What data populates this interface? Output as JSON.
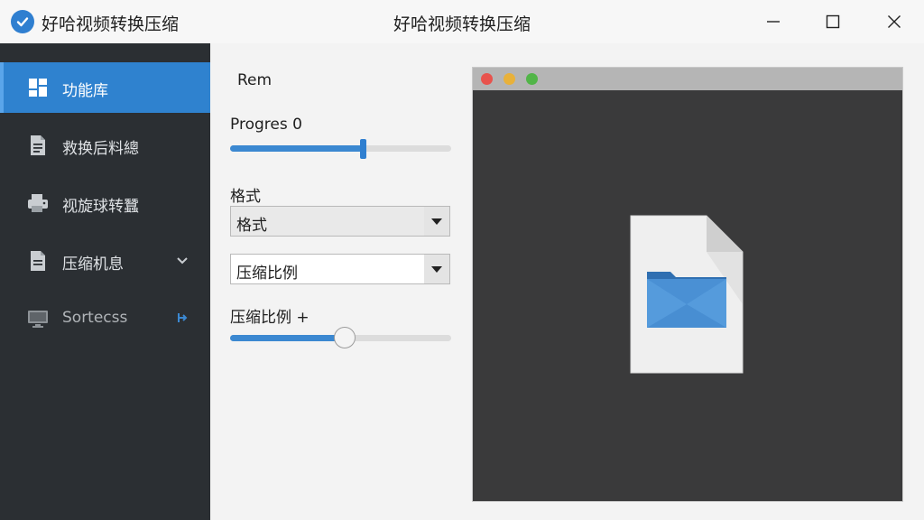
{
  "window": {
    "app_name": "好哈视频转换压缩",
    "title": "好哈视频转换压缩"
  },
  "sidebar": {
    "items": [
      {
        "label": "功能库",
        "icon": "dashboard-icon",
        "active": true
      },
      {
        "label": "救换后料總",
        "icon": "document-icon",
        "active": false
      },
      {
        "label": "视旋球转蠶",
        "icon": "printer-icon",
        "active": false
      },
      {
        "label": "压缩机息",
        "icon": "file-icon",
        "active": false,
        "extra": "chevron-down-icon"
      },
      {
        "label": "Sortecss",
        "icon": "monitor-icon",
        "active": false,
        "extra": "pin-icon"
      }
    ]
  },
  "panel": {
    "rem_label": "Rem",
    "progress_label": "Progres 0",
    "progress_value": 0.6,
    "format_label": "格式",
    "format_select_value": "格式",
    "ratio_select_value": "压缩比例",
    "ratio_slider_label": "压缩比例 +",
    "ratio_slider_value": 0.52
  },
  "preview": {
    "icons": [
      "close-dot",
      "minimize-dot",
      "zoom-dot",
      "folder-file-icon"
    ]
  },
  "colors": {
    "accent": "#2f82cf",
    "sidebar_bg": "#2b2f33",
    "preview_bg": "#3a3a3b"
  }
}
